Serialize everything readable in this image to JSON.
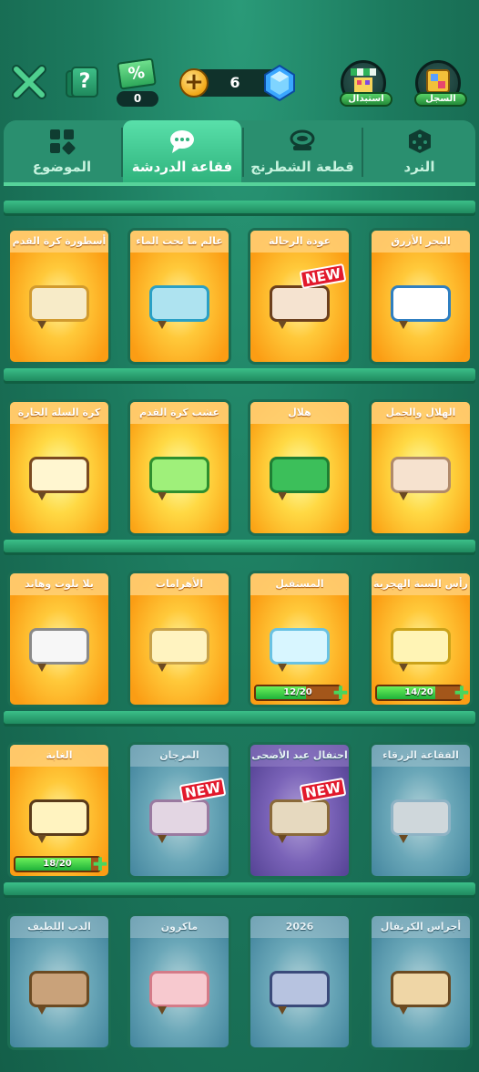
{
  "topbar": {
    "tickets_count": "0",
    "ticket_symbol": "%",
    "gems_count": "6",
    "exchange_label": "استبدال",
    "record_label": "السجل"
  },
  "tabs": [
    {
      "label": "الموضوع",
      "icon": "grid-icon",
      "active": false
    },
    {
      "label": "فقاعة الدردشة",
      "icon": "chat-bubble-icon",
      "active": true
    },
    {
      "label": "قطعة الشطرنج",
      "icon": "chess-piece-icon",
      "active": false
    },
    {
      "label": "النرد",
      "icon": "dice-icon",
      "active": false
    }
  ],
  "cards": [
    {
      "title": "البحر الأزرق",
      "bubble_color": "#ffffff",
      "border_color": "#2f7fc1"
    },
    {
      "title": "عودة الرحالة",
      "bubble_color": "#f5e3d0",
      "border_color": "#6b3f1d",
      "new": true
    },
    {
      "title": "عالم ما تحت الماء",
      "bubble_color": "#aee3f0",
      "border_color": "#2aa0c5"
    },
    {
      "title": "أسطورة كرة القدم",
      "bubble_color": "#f7ebc8",
      "border_color": "#d19a2e"
    },
    {
      "title": "الهلال والجمل",
      "bubble_color": "#f6e2cf",
      "border_color": "#b08a6b"
    },
    {
      "title": "هلال",
      "bubble_color": "#3cbf5a",
      "border_color": "#1e7f34"
    },
    {
      "title": "عشب كرة القدم",
      "bubble_color": "#9ff07a",
      "border_color": "#2e8f2f"
    },
    {
      "title": "كرة السلة الحارة",
      "bubble_color": "#fff6d0",
      "border_color": "#7a4a21"
    },
    {
      "title": "رأس السنة الهجرية",
      "bubble_color": "#fff4b5",
      "border_color": "#caa21a",
      "progress": "14/20",
      "progress_value": 0.7
    },
    {
      "title": "المستقبل",
      "bubble_color": "#d8f6ff",
      "border_color": "#69c2e3",
      "progress": "12/20",
      "progress_value": 0.6
    },
    {
      "title": "الأهرامات",
      "bubble_color": "#fff3c0",
      "border_color": "#c8a14a"
    },
    {
      "title": "يلا بلوت وهاند",
      "bubble_color": "#f7f7f7",
      "border_color": "#8a8a8a"
    },
    {
      "title": "الفقاعة الزرقاء",
      "bubble_color": "#cfd7db",
      "border_color": "#8fb3c5",
      "locked": true
    },
    {
      "title": "احتفال عيد الأضحى",
      "bubble_color": "#e6d9bf",
      "border_color": "#8a6a3a",
      "new": true,
      "purple": true
    },
    {
      "title": "المرجان",
      "bubble_color": "#e3d6e3",
      "border_color": "#9a7aa0",
      "new": true,
      "locked": true
    },
    {
      "title": "الغابة",
      "bubble_color": "#fff3c0",
      "border_color": "#5a3a1a",
      "progress": "18/20",
      "progress_value": 0.9
    },
    {
      "title": "أجراس الكرنفال",
      "bubble_color": "#efd6a6",
      "border_color": "#6b4a22",
      "locked": true
    },
    {
      "title": "2026",
      "bubble_color": "#b7c3e0",
      "border_color": "#3a4a7a",
      "locked": true
    },
    {
      "title": "ماكرون",
      "bubble_color": "#f7c9cf",
      "border_color": "#d47b88",
      "locked": true
    },
    {
      "title": "الدب اللطيف",
      "bubble_color": "#c9a27a",
      "border_color": "#6b4a22",
      "locked": true
    }
  ],
  "labels": {
    "new_badge": "NEW"
  }
}
